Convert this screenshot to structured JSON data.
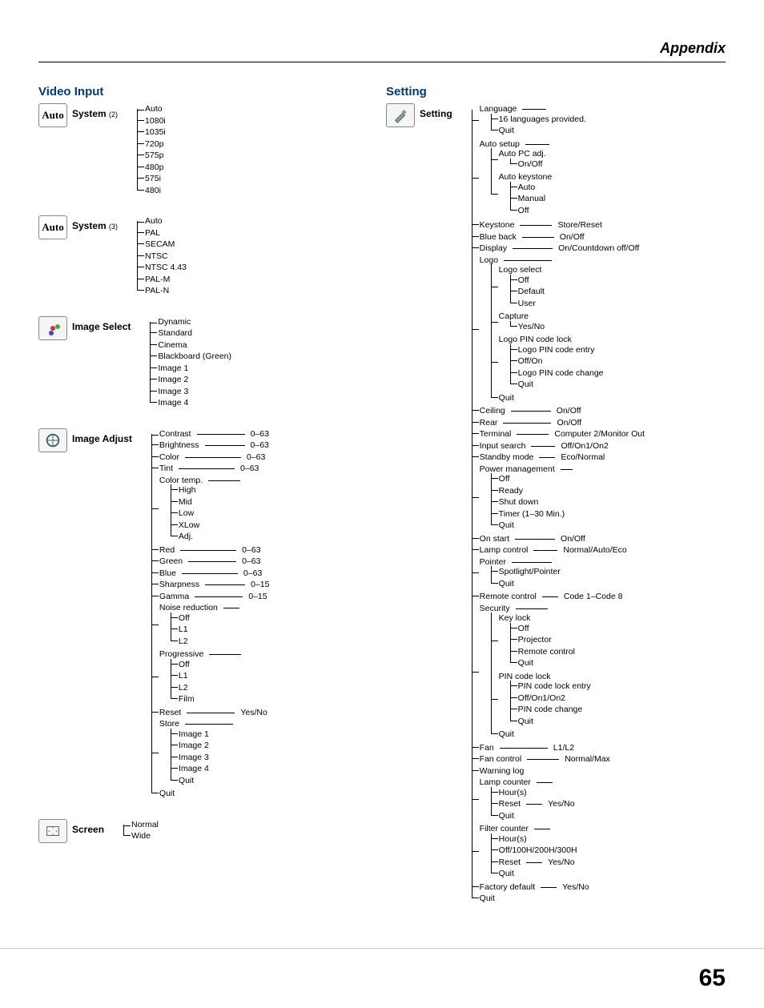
{
  "header": "Appendix",
  "page_number": "65",
  "left": {
    "title": "Video Input",
    "system2": {
      "label": "System",
      "sub": "(2)",
      "items": [
        "Auto",
        "1080i",
        "1035i",
        "720p",
        "575p",
        "480p",
        "575i",
        "480i"
      ]
    },
    "system3": {
      "label": "System",
      "sub": "(3)",
      "items": [
        "Auto",
        "PAL",
        "SECAM",
        "NTSC",
        "NTSC 4.43",
        "PAL-M",
        "PAL-N"
      ]
    },
    "image_select": {
      "label": "Image Select",
      "items": [
        "Dynamic",
        "Standard",
        "Cinema",
        "Blackboard (Green)",
        "Image 1",
        "Image 2",
        "Image 3",
        "Image 4"
      ]
    },
    "image_adjust": {
      "label": "Image Adjust",
      "contrast": {
        "n": "Contrast",
        "v": "0–63"
      },
      "brightness": {
        "n": "Brightness",
        "v": "0–63"
      },
      "color": {
        "n": "Color",
        "v": "0–63"
      },
      "tint": {
        "n": "Tint",
        "v": "0–63"
      },
      "colortemp": {
        "n": "Color temp.",
        "items": [
          "High",
          "Mid",
          "Low",
          "XLow",
          "Adj."
        ]
      },
      "red": {
        "n": "Red",
        "v": "0–63"
      },
      "green": {
        "n": "Green",
        "v": "0–63"
      },
      "blue": {
        "n": "Blue",
        "v": "0–63"
      },
      "sharp": {
        "n": "Sharpness",
        "v": "0–15"
      },
      "gamma": {
        "n": "Gamma",
        "v": "0–15"
      },
      "nr": {
        "n": "Noise reduction",
        "items": [
          "Off",
          "L1",
          "L2"
        ]
      },
      "prog": {
        "n": "Progressive",
        "items": [
          "Off",
          "L1",
          "L2",
          "Film"
        ]
      },
      "reset": {
        "n": "Reset",
        "v": "Yes/No"
      },
      "store": {
        "n": "Store",
        "items": [
          "Image 1",
          "Image 2",
          "Image 3",
          "Image 4",
          "Quit"
        ]
      },
      "quit": "Quit"
    },
    "screen": {
      "label": "Screen",
      "items": [
        "Normal",
        "Wide"
      ]
    }
  },
  "right": {
    "title": "Setting",
    "root": "Setting",
    "language": {
      "n": "Language",
      "items": [
        "16 languages provided.",
        "Quit"
      ]
    },
    "autosetup": {
      "n": "Auto setup",
      "pcadj": {
        "n": "Auto PC adj.",
        "v": "On/Off"
      },
      "autokey": {
        "n": "Auto keystone",
        "items": [
          "Auto",
          "Manual",
          "Off"
        ]
      }
    },
    "keystone": {
      "n": "Keystone",
      "v": "Store/Reset"
    },
    "blueback": {
      "n": "Blue back",
      "v": "On/Off"
    },
    "display": {
      "n": "Display",
      "v": "On/Countdown off/Off"
    },
    "logo": {
      "n": "Logo",
      "select": {
        "n": "Logo select",
        "items": [
          "Off",
          "Default",
          "User"
        ]
      },
      "capture": {
        "n": "Capture",
        "v": "Yes/No"
      },
      "pin": {
        "n": "Logo PIN code lock",
        "items": [
          "Logo PIN code entry",
          "Off/On",
          "Logo PIN code change",
          "Quit"
        ]
      },
      "quit": "Quit"
    },
    "ceiling": {
      "n": "Ceiling",
      "v": "On/Off"
    },
    "rear": {
      "n": "Rear",
      "v": "On/Off"
    },
    "terminal": {
      "n": "Terminal",
      "v": "Computer 2/Monitor Out"
    },
    "inputsearch": {
      "n": "Input search",
      "v": "Off/On1/On2"
    },
    "standby": {
      "n": "Standby mode",
      "v": "Eco/Normal"
    },
    "power": {
      "n": "Power management",
      "items": [
        "Off",
        "Ready",
        "Shut down",
        "Timer (1–30 Min.)",
        "Quit"
      ]
    },
    "onstart": {
      "n": "On start",
      "v": "On/Off"
    },
    "lampctrl": {
      "n": "Lamp control",
      "v": "Normal/Auto/Eco"
    },
    "pointer": {
      "n": "Pointer",
      "items": [
        "Spotlight/Pointer",
        "Quit"
      ]
    },
    "remote": {
      "n": "Remote control",
      "v": "Code 1–Code 8"
    },
    "security": {
      "n": "Security",
      "keylock": {
        "n": "Key lock",
        "items": [
          "Off",
          "Projector",
          "Remote control",
          "Quit"
        ]
      },
      "pinlock": {
        "n": "PIN code lock",
        "items": [
          "PIN code lock entry",
          "Off/On1/On2",
          "PIN code change",
          "Quit"
        ]
      },
      "quit": "Quit"
    },
    "fan": {
      "n": "Fan",
      "v": "L1/L2"
    },
    "fanctrl": {
      "n": "Fan control",
      "v": "Normal/Max"
    },
    "warnlog": {
      "n": "Warning log"
    },
    "lampcnt": {
      "n": "Lamp counter",
      "items": [
        "Hour(s)"
      ],
      "reset": {
        "n": "Reset",
        "v": "Yes/No"
      },
      "quit": "Quit"
    },
    "filtcnt": {
      "n": "Filter counter",
      "h": "Hour(s)",
      "range": "Off/100H/200H/300H",
      "reset": {
        "n": "Reset",
        "v": "Yes/No"
      },
      "quit": "Quit"
    },
    "factory": {
      "n": "Factory default",
      "v": "Yes/No"
    },
    "quit": "Quit"
  }
}
